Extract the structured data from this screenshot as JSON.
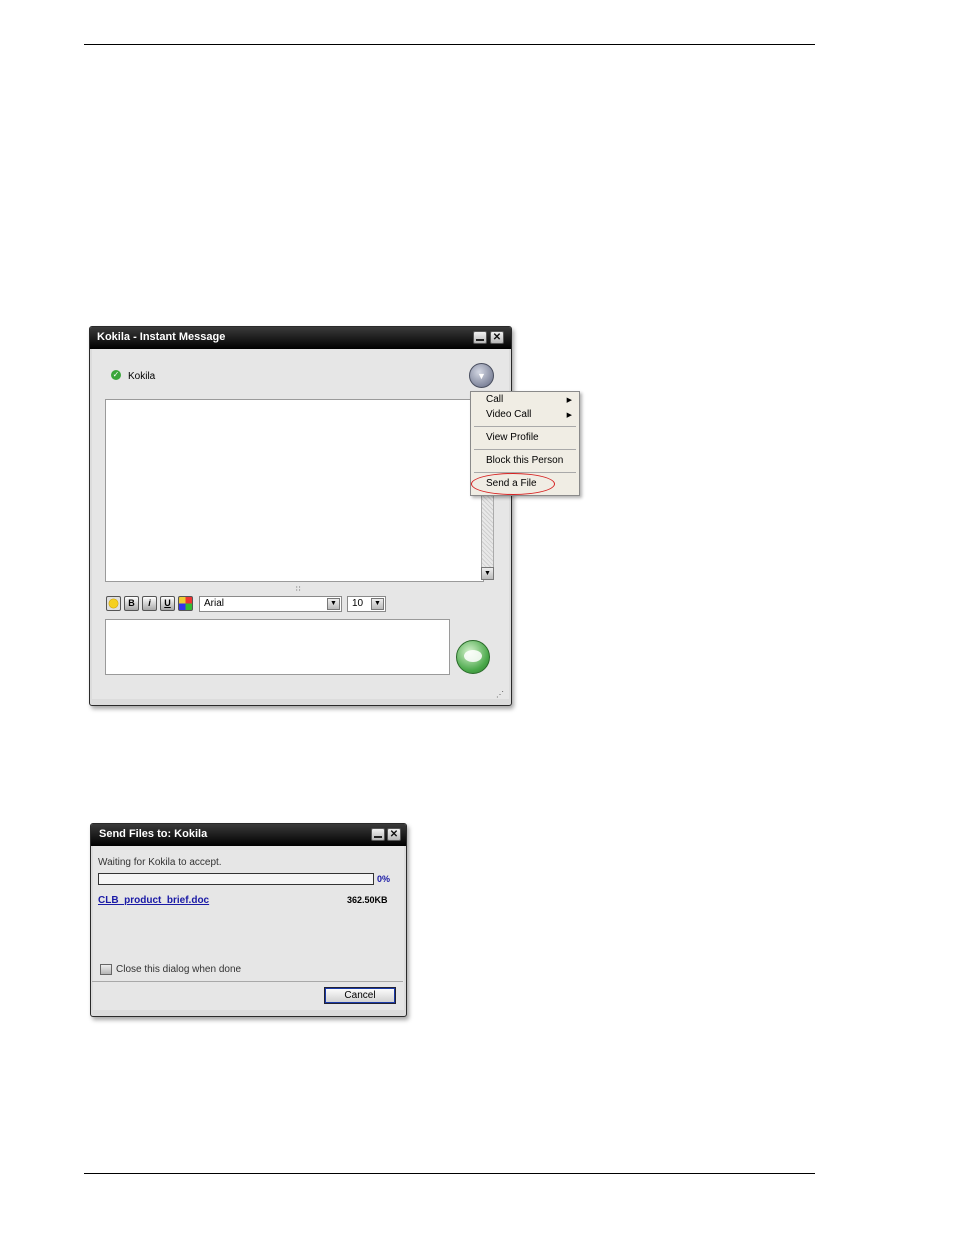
{
  "im_window": {
    "title": "Kokila - Instant Message",
    "contact_name": "Kokila",
    "font_name": "Arial",
    "font_size": "10",
    "format_buttons": {
      "bold": "B",
      "italic": "i",
      "underline": "U"
    }
  },
  "context_menu": {
    "items": [
      "Call",
      "Video Call",
      "View Profile",
      "Block this Person",
      "Send a File"
    ]
  },
  "send_dialog": {
    "title": "Send Files to: Kokila",
    "status": "Waiting for Kokila to accept.",
    "progress_percent": "0%",
    "progress_value": 0,
    "file_name": "CLB_product_brief.doc",
    "file_size": "362.50KB",
    "close_when_done_label": "Close this dialog when done",
    "cancel_label": "Cancel"
  },
  "colors": {
    "accent_link": "#1a1aa6",
    "highlight_ring": "#d62020",
    "status_green": "#3aa63a"
  }
}
